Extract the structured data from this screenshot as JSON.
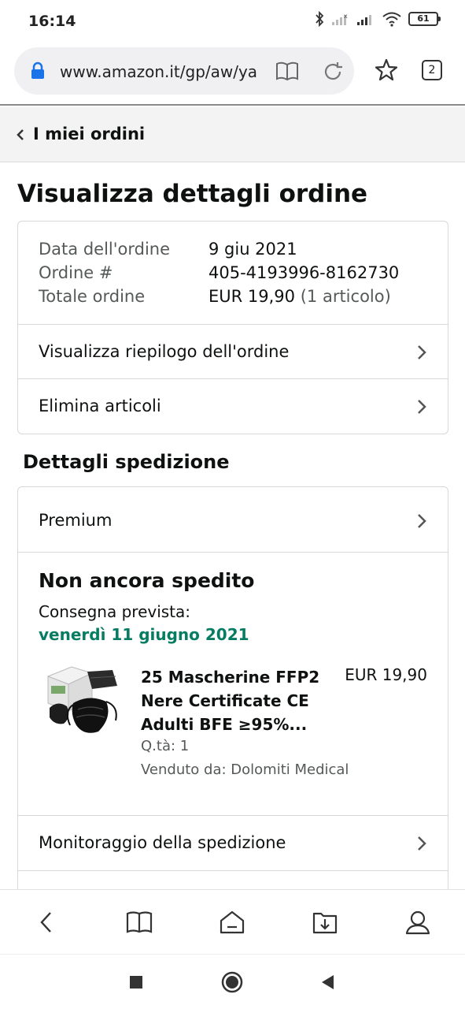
{
  "status_bar": {
    "time": "16:14",
    "battery": "61"
  },
  "browser": {
    "url": "www.amazon.it/gp/aw/ya",
    "tab_count": "2"
  },
  "nav": {
    "back_label": "I miei ordini"
  },
  "page": {
    "title": "Visualizza dettagli ordine"
  },
  "order": {
    "date_label": "Data dell'ordine",
    "date_value": "9 giu 2021",
    "number_label": "Ordine #",
    "number_value": "405-4193996-8162730",
    "total_label": "Totale ordine",
    "total_value": "EUR 19,90",
    "total_items": "(1 articolo)",
    "summary_link": "Visualizza riepilogo dell'ordine",
    "delete_link": "Elimina articoli"
  },
  "shipping": {
    "section_title": "Dettagli spedizione",
    "method": "Premium",
    "status": "Non ancora spedito",
    "delivery_label": "Consegna prevista:",
    "delivery_date": "venerdì 11 giugno 2021",
    "tracking_link": "Monitoraggio della spedizione"
  },
  "product": {
    "title": "25 Mascherine FFP2 Nere Certificate CE Adulti BFE ≥95%...",
    "price": "EUR 19,90",
    "quantity": "Q.tà: 1",
    "seller": "Venduto da: Dolomiti Medical"
  },
  "colors": {
    "delivery_green": "#067d62",
    "link_blue": "#1a73e8"
  },
  "icons": {
    "bottom_nav": [
      "back-icon",
      "book-icon",
      "home-icon",
      "download-icon",
      "profile-icon"
    ],
    "system_nav": [
      "recents-icon",
      "home-circle-icon",
      "back-triangle-icon"
    ]
  }
}
